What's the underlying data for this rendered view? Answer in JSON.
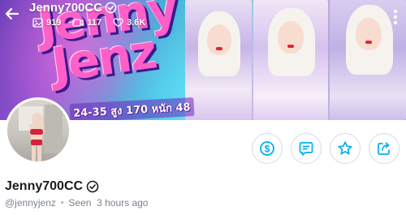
{
  "header": {
    "username": "Jenny700CC",
    "stats": [
      {
        "icon": "image-icon",
        "value": "919"
      },
      {
        "icon": "video-icon",
        "value": "117"
      },
      {
        "icon": "heart-icon",
        "value": "3.6K"
      }
    ]
  },
  "banner": {
    "title_line1": "Jenny",
    "title_line2": "Jenz",
    "stats_text": "24-35 สูง 170 หนัก 48"
  },
  "profile": {
    "display_name": "Jenny700CC",
    "handle": "@jennyjenz",
    "separator": "•",
    "last_seen": "Seen  3 hours ago"
  },
  "actions": [
    {
      "name": "tip-button",
      "icon": "dollar-icon"
    },
    {
      "name": "message-button",
      "icon": "message-icon"
    },
    {
      "name": "favorite-button",
      "icon": "star-icon"
    },
    {
      "name": "share-button",
      "icon": "share-icon"
    }
  ],
  "colors": {
    "accent": "#00aff0",
    "verified": "#ffffff",
    "text_primary": "#1a1a1a",
    "text_secondary": "#7a8290"
  }
}
